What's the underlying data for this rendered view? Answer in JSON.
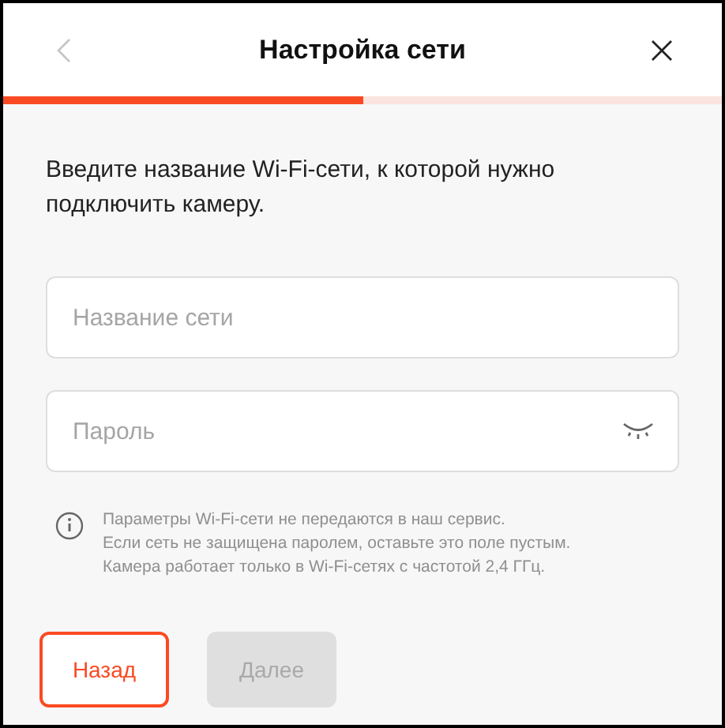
{
  "header": {
    "title": "Настройка сети",
    "back_disabled": true
  },
  "progress": {
    "level": 0.5
  },
  "instruction": "Введите название Wi-Fi-сети, к которой нужно подключить камеру.",
  "fields": [
    {
      "kind": "text",
      "placeholder": "Название сети"
    },
    {
      "kind": "password",
      "placeholder": "Пароль"
    }
  ],
  "info_lines": [
    "Параметры Wi-Fi-сети не передаются в наш сервис.",
    "Если сеть не защищена паролем, оставьте это поле пустым.",
    "Камера работает только в Wi-Fi-сетях с частотой 2,4 ГГц."
  ],
  "buttons": [
    {
      "label": "Назад",
      "kind": "secondary",
      "disabled": false
    },
    {
      "label": "Далее",
      "kind": "primary",
      "disabled": true
    }
  ]
}
